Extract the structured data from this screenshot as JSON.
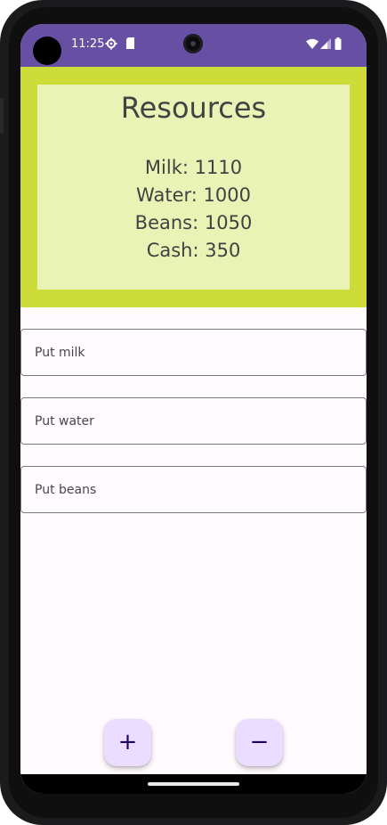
{
  "status_bar": {
    "time": "11:25",
    "colors": {
      "background": "#6750a4"
    }
  },
  "resources": {
    "title": "Resources",
    "lines": [
      "Milk: 1110",
      "Water: 1000",
      "Beans: 1050",
      "Cash: 350"
    ],
    "colors": {
      "outer": "#cddc39",
      "inner": "#e9f3b6"
    }
  },
  "inputs": {
    "milk": {
      "placeholder": "Put milk",
      "value": ""
    },
    "water": {
      "placeholder": "Put water",
      "value": ""
    },
    "beans": {
      "placeholder": "Put beans",
      "value": ""
    }
  },
  "fabs": {
    "add_label": "+",
    "remove_label": "−",
    "color": "#eaddff"
  },
  "icons": {
    "settings": "gear-icon",
    "sim": "sim-card-icon",
    "wifi": "wifi-icon",
    "signal": "signal-icon",
    "battery": "battery-icon"
  }
}
